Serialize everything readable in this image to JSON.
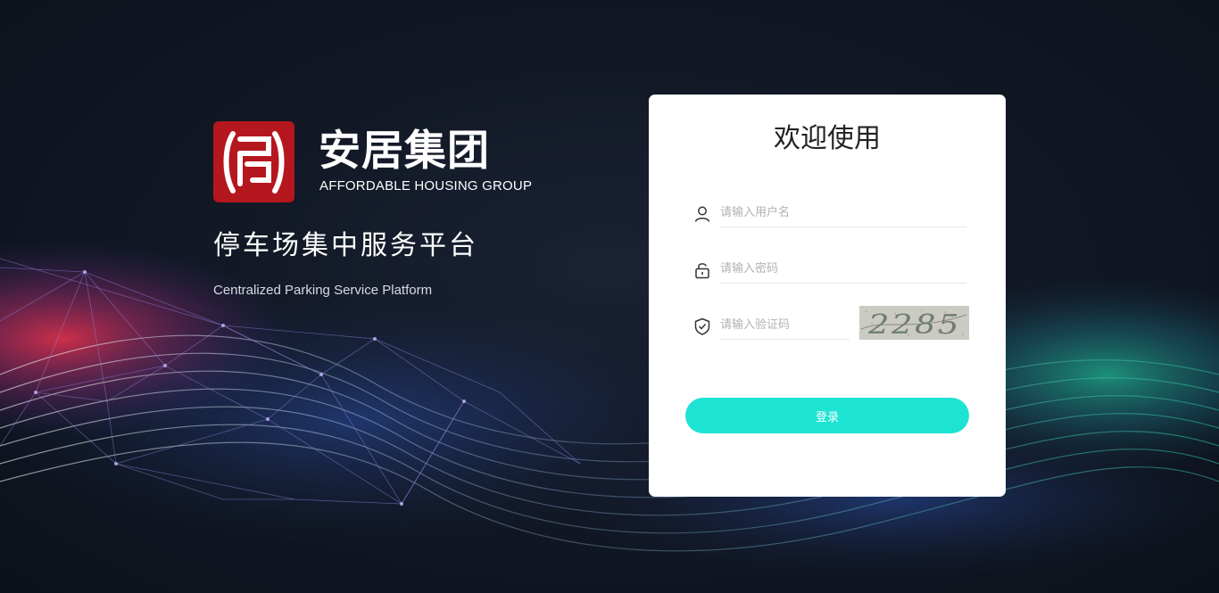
{
  "brand": {
    "logo_cn": "安居集团",
    "logo_en": "AFFORDABLE HOUSING GROUP",
    "logo_color": "#b4171d"
  },
  "platform": {
    "title_cn": "停车场集中服务平台",
    "title_en": "Centralized Parking Service Platform"
  },
  "login": {
    "title": "欢迎使用",
    "username_placeholder": "请输入用户名",
    "password_placeholder": "请输入密码",
    "captcha_placeholder": "请输入验证码",
    "captcha_code": "2285",
    "submit_label": "登录",
    "accent_color": "#1de3d2",
    "icons": {
      "username": "user-icon",
      "password": "lock-icon",
      "captcha": "shield-check-icon"
    }
  }
}
